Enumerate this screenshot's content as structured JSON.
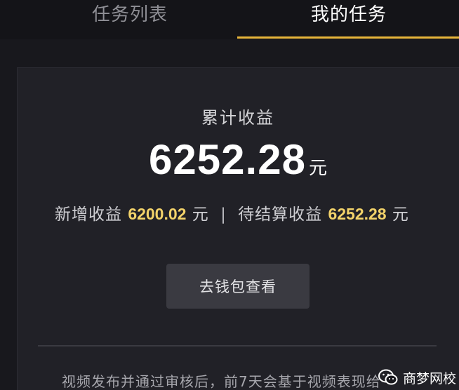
{
  "tabs": [
    {
      "label": "任务列表",
      "active": false
    },
    {
      "label": "我的任务",
      "active": true
    }
  ],
  "earnings": {
    "title": "累计收益",
    "total": "6252.28",
    "unit": "元",
    "new_label": "新增收益",
    "new_value": "6200.02",
    "new_unit": "元",
    "separator": "|",
    "pending_label": "待结算收益",
    "pending_value": "6252.28",
    "pending_unit": "元"
  },
  "wallet_button": "去钱包查看",
  "note": "视频发布并通过审核后，前7天会基于视频表现给",
  "watermark": {
    "text": "商梦网校",
    "icon": "wechat-icon"
  },
  "colors": {
    "accent": "#e7b53a",
    "value_highlight": "#f3d36a",
    "background": "#18181d",
    "card": "#212127"
  }
}
